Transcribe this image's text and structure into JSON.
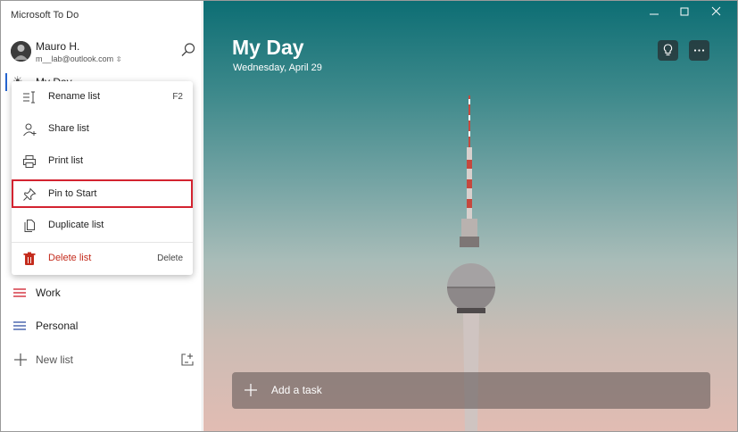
{
  "app": {
    "title": "Microsoft To Do"
  },
  "account": {
    "name": "Mauro H.",
    "email": "m__lab@outlook.com"
  },
  "sidebar": {
    "partial_item": "My Day",
    "lists": [
      {
        "label": "Work",
        "color": "#e06c75"
      },
      {
        "label": "Personal",
        "color": "#7a8ec4"
      }
    ],
    "new_list_label": "New list"
  },
  "context_menu": {
    "items": [
      {
        "label": "Rename list",
        "shortcut": "F2",
        "icon": "rename-icon"
      },
      {
        "label": "Share list",
        "shortcut": "",
        "icon": "share-person-icon"
      },
      {
        "label": "Print list",
        "shortcut": "",
        "icon": "printer-icon"
      },
      {
        "label": "Pin to Start",
        "shortcut": "",
        "icon": "pin-icon",
        "highlighted": true
      },
      {
        "label": "Duplicate list",
        "shortcut": "",
        "icon": "duplicate-icon"
      },
      {
        "label": "Delete list",
        "shortcut": "Delete",
        "icon": "trash-icon",
        "danger": true
      }
    ]
  },
  "main": {
    "title": "My Day",
    "date": "Wednesday, April 29",
    "add_task_label": "Add a task"
  },
  "colors": {
    "accent": "#2564cf",
    "danger": "#c42b1c",
    "highlight_border": "#d32330"
  }
}
